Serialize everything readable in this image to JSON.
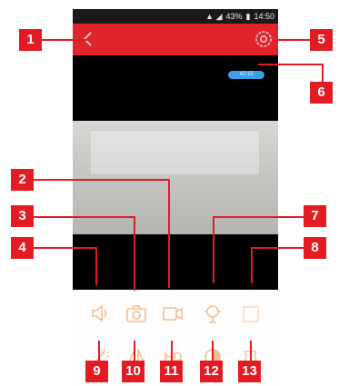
{
  "status_bar": {
    "battery": "43%",
    "time": "14:50"
  },
  "video": {
    "timestamp": "42:15"
  },
  "controls": {
    "hd_label": "HD"
  },
  "callouts": [
    "1",
    "2",
    "3",
    "4",
    "5",
    "6",
    "7",
    "8",
    "9",
    "10",
    "11",
    "12",
    "13"
  ],
  "colors": {
    "accent": "#e0242b",
    "icon": "#f4be91",
    "callout": "#e31b23",
    "badge": "#3d9ee8"
  },
  "icons": [
    "back-arrow",
    "settings-gear",
    "speaker",
    "camera",
    "video-record",
    "intercom",
    "fullscreen",
    "brightness",
    "mirror",
    "hd",
    "contrast",
    "flag"
  ]
}
